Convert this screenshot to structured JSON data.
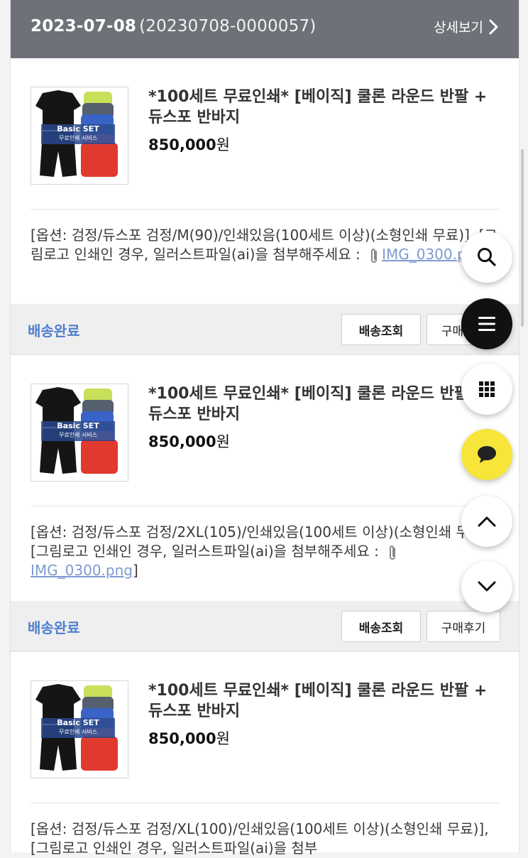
{
  "order": {
    "date": "2023-07-08",
    "number": "(20230708-0000057)",
    "detail_link": "상세보기"
  },
  "items": [
    {
      "name": "*100세트 무료인쇄* [베이직] 쿨론 라운드 반팔 + 듀스포 반바지",
      "price": "850,000",
      "currency": "원",
      "option_text": "[옵션: 검정/듀스포 검정/M(90)/인쇄있음(100세트 이상)(소형인쇄 무료)], [그림로고 인쇄인 경우, 일러스트파일(ai)을 첨부해주세요 :",
      "attachment": "IMG_0300.png",
      "option_close": "]",
      "status": "배송완료",
      "track_button": "배송조회",
      "review_button": "구매후기",
      "badge_line1": "Basic SET",
      "badge_line2": "무료인쇄 서비스"
    },
    {
      "name": "*100세트 무료인쇄* [베이직] 쿨론 라운드 반팔 + 듀스포 반바지",
      "price": "850,000",
      "currency": "원",
      "option_text": "[옵션: 검정/듀스포 검정/2XL(105)/인쇄있음(100세트 이상)(소형인쇄 무료)], [그림로고 인쇄인 경우, 일러스트파일(ai)을 첨부해주세요 :",
      "attachment": "IMG_0300.png",
      "option_close": "]",
      "status": "배송완료",
      "track_button": "배송조회",
      "review_button": "구매후기",
      "badge_line1": "Basic SET",
      "badge_line2": "무료인쇄 서비스"
    },
    {
      "name": "*100세트 무료인쇄* [베이직] 쿨론 라운드 반팔 + 듀스포 반바지",
      "price": "850,000",
      "currency": "원",
      "option_text": "[옵션: 검정/듀스포 검정/XL(100)/인쇄있음(100세트 이상)(소형인쇄 무료)], [그림로고 인쇄인 경우, 일러스트파일(ai)을 첨부",
      "badge_line1": "Basic SET",
      "badge_line2": "무료인쇄 서비스"
    }
  ],
  "floating_buttons": [
    "search-icon",
    "menu-icon",
    "grid-icon",
    "chat-icon",
    "arrow-up-icon",
    "arrow-down-icon"
  ],
  "colors": {
    "header_bg": "#6e7278",
    "status_blue": "#4f7fd0",
    "kakao_yellow": "#f7e53a"
  }
}
